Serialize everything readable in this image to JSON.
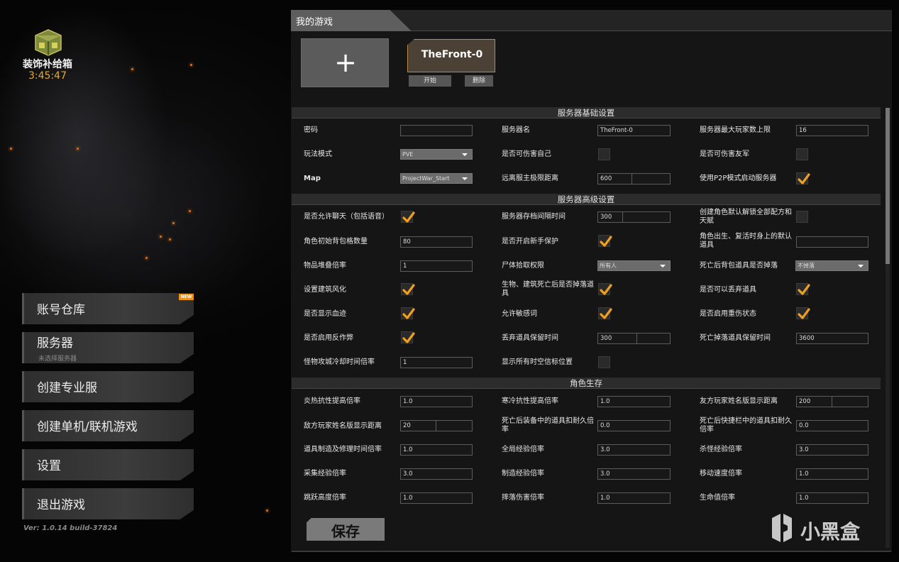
{
  "reward": {
    "label": "装饰补给箱",
    "timer": "3:45:47"
  },
  "menu": {
    "items": [
      {
        "label": "账号仓库",
        "badge": "NEW"
      },
      {
        "label": "服务器",
        "sub": "未选择服务器"
      },
      {
        "label": "创建专业服"
      },
      {
        "label": "创建单机/联机游戏"
      },
      {
        "label": "设置"
      },
      {
        "label": "退出游戏"
      }
    ],
    "version": "Ver: 1.0.14 build-37824"
  },
  "panel": {
    "tab": "我的游戏",
    "add_label": "+",
    "game": {
      "name": "TheFront-0",
      "start": "开始",
      "delete": "删除"
    },
    "save": "保存"
  },
  "sections": {
    "basic": "服务器基础设置",
    "advanced": "服务器高级设置",
    "survival": "角色生存"
  },
  "basic": {
    "password_label": "密码",
    "password_value": "",
    "server_name_label": "服务器名",
    "server_name_value": "TheFront-0",
    "max_players_label": "服务器最大玩家数上限",
    "max_players_value": "16",
    "mode_label": "玩法模式",
    "mode_value": "PVE",
    "self_dmg_label": "是否可伤害自己",
    "self_dmg": false,
    "ff_label": "是否可伤害友军",
    "ff": false,
    "map_label": "Map",
    "map_value": "ProjectWar_Start",
    "far_label": "远离服主极限距离",
    "far_value": "600",
    "p2p_label": "使用P2P模式启动服务器",
    "p2p": true
  },
  "advanced": {
    "chat_label": "是否允许聊天（包括语音）",
    "chat": true,
    "save_interval_label": "服务器存档间隔时间",
    "save_interval_value": "300",
    "unlock_all_label": "创建角色默认解锁全部配方和天赋",
    "unlock_all": false,
    "bag_label": "角色初始背包格数量",
    "bag_value": "80",
    "newbie_label": "是否开启新手保护",
    "newbie": true,
    "respawn_label": "角色出生、复活时身上的默认道具",
    "respawn_value": "",
    "stack_label": "物品堆叠倍率",
    "stack_value": "1",
    "loot_label": "尸体拾取权限",
    "loot_value": "所有人",
    "death_drop_label": "死亡后背包道具是否掉落",
    "death_drop_value": "不掉落",
    "decay_label": "设置建筑风化",
    "decay": true,
    "creature_drop_label": "生物、建筑死亡后是否掉落道具",
    "creature_drop": true,
    "discard_label": "是否可以丢弃道具",
    "discard": true,
    "blood_label": "是否显示血迹",
    "blood": true,
    "sensitive_label": "允许敏感词",
    "sensitive": true,
    "injury_label": "是否启用重伤状态",
    "injury": true,
    "anticheat_label": "是否启用反作弊",
    "anticheat": true,
    "discard_keep_label": "丢弃道具保留时间",
    "discard_keep_value": "300",
    "death_keep_label": "死亡掉落道具保留时间",
    "death_keep_value": "3600",
    "siege_label": "怪物攻城冷却时间倍率",
    "siege_value": "1",
    "airdrop_label": "显示所有时空信标位置",
    "airdrop": false
  },
  "survival": {
    "heat_label": "炎热抗性提高倍率",
    "heat_value": "1.0",
    "cold_label": "寒冷抗性提高倍率",
    "cold_value": "1.0",
    "friend_name_label": "友方玩家姓名版显示距离",
    "friend_name_value": "200",
    "enemy_name_label": "敌方玩家姓名版显示距离",
    "enemy_name_value": "20",
    "equip_dur_label": "死亡后装备中的道具扣耐久倍率",
    "equip_dur_value": "0.0",
    "quick_dur_label": "死亡后快捷栏中的道具扣耐久倍率",
    "quick_dur_value": "0.0",
    "craft_label": "道具制造及修理时间倍率",
    "craft_value": "1.0",
    "global_xp_label": "全局经验倍率",
    "global_xp_value": "3.0",
    "kill_xp_label": "杀怪经验倍率",
    "kill_xp_value": "3.0",
    "gather_xp_label": "采集经验倍率",
    "gather_xp_value": "3.0",
    "make_xp_label": "制造经验倍率",
    "make_xp_value": "3.0",
    "move_label": "移动速度倍率",
    "move_value": "1.0",
    "jump_label": "跳跃高度倍率",
    "jump_value": "1.0",
    "fall_label": "摔落伤害倍率",
    "fall_value": "1.0",
    "hp_label": "生命值倍率",
    "hp_value": "1.0"
  },
  "watermark": "小黑盒",
  "colors": {
    "accent": "#e89320",
    "check": "#f0a020",
    "timer": "#e2a93a"
  }
}
